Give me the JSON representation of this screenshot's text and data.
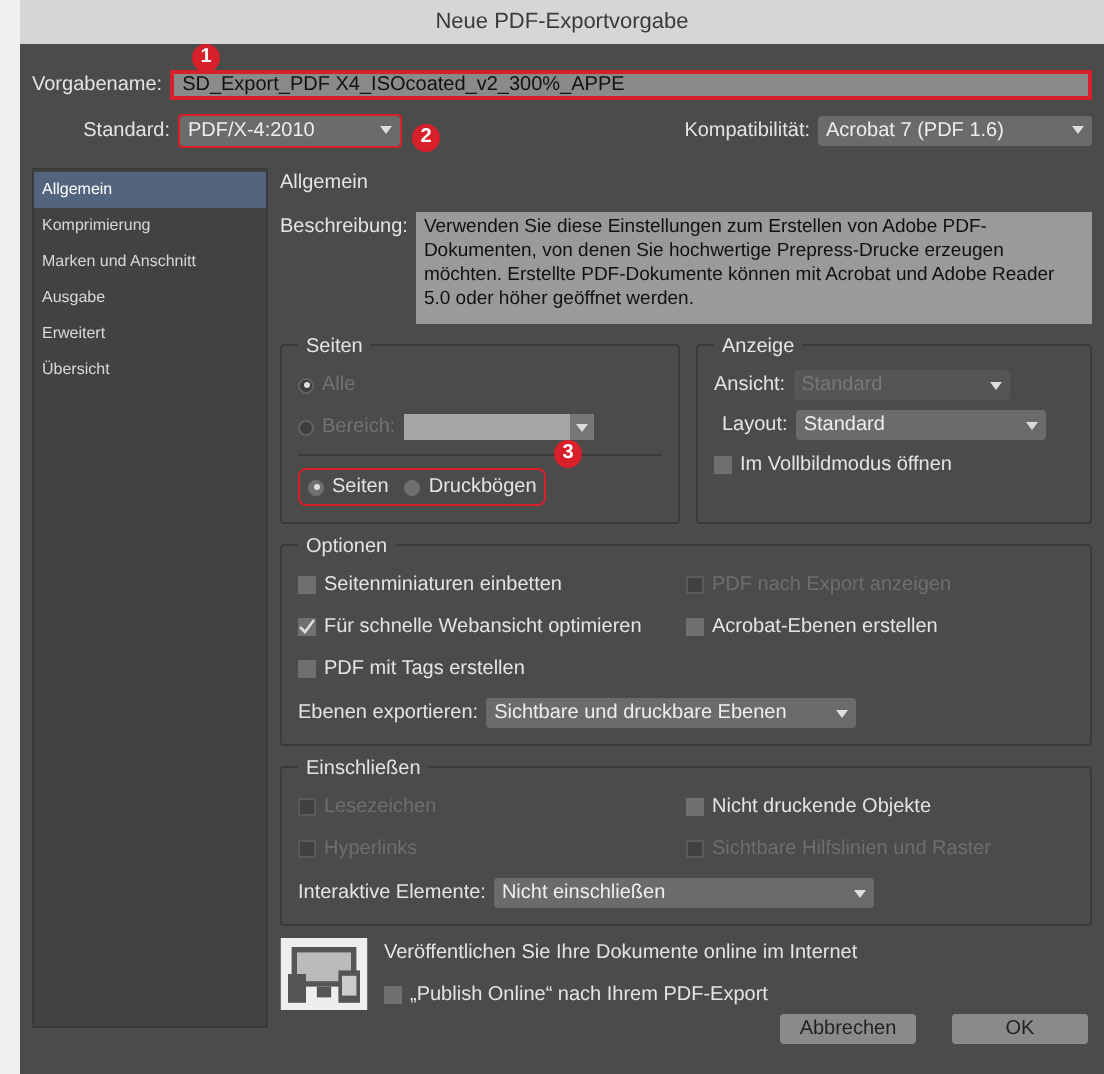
{
  "window": {
    "title": "Neue PDF-Exportvorgabe"
  },
  "preset_name": {
    "label": "Vorgabename:",
    "value": "SD_Export_PDF X4_ISOcoated_v2_300%_APPE",
    "highlighted": true,
    "badge": "1"
  },
  "standard": {
    "label": "Standard:",
    "value": "PDF/X-4:2010",
    "highlighted": true,
    "badge": "2"
  },
  "compatibility": {
    "label": "Kompatibilität:",
    "value": "Acrobat 7 (PDF 1.6)"
  },
  "sidebar": {
    "items": [
      {
        "label": "Allgemein",
        "selected": true
      },
      {
        "label": "Komprimierung",
        "selected": false
      },
      {
        "label": "Marken und Anschnitt",
        "selected": false
      },
      {
        "label": "Ausgabe",
        "selected": false
      },
      {
        "label": "Erweitert",
        "selected": false
      },
      {
        "label": "Übersicht",
        "selected": false
      }
    ]
  },
  "section_title": "Allgemein",
  "description": {
    "label": "Beschreibung:",
    "value": "Verwenden Sie diese Einstellungen zum Erstellen von Adobe PDF-Dokumenten, von denen Sie hochwertige Prepress-Drucke erzeugen möchten. Erstellte PDF-Dokumente können mit Acrobat und Adobe Reader 5.0 oder höher geöffnet werden."
  },
  "pages": {
    "title": "Seiten",
    "range_options": [
      {
        "label": "Alle",
        "selected": true,
        "disabled": true
      },
      {
        "label": "Bereich:",
        "selected": false,
        "disabled": true
      }
    ],
    "mode_options": [
      {
        "label": "Seiten",
        "selected": true
      },
      {
        "label": "Druckbögen",
        "selected": false
      }
    ],
    "highlighted": true,
    "badge": "3"
  },
  "display": {
    "title": "Anzeige",
    "view": {
      "label": "Ansicht:",
      "value": "Standard",
      "disabled": true
    },
    "layout": {
      "label": "Layout:",
      "value": "Standard",
      "disabled": false
    },
    "fullscreen": {
      "label": "Im Vollbildmodus öffnen",
      "checked": false,
      "disabled": false
    }
  },
  "options": {
    "title": "Optionen",
    "checkboxes": [
      {
        "label": "Seitenminiaturen einbetten",
        "checked": false,
        "disabled": false
      },
      {
        "label": "PDF nach Export anzeigen",
        "checked": false,
        "disabled": true
      },
      {
        "label": "Für schnelle Webansicht optimieren",
        "checked": true,
        "disabled": false
      },
      {
        "label": "Acrobat-Ebenen erstellen",
        "checked": false,
        "disabled": false
      },
      {
        "label": "PDF mit Tags erstellen",
        "checked": false,
        "disabled": false
      }
    ],
    "export_layers": {
      "label": "Ebenen exportieren:",
      "value": "Sichtbare und druckbare Ebenen"
    }
  },
  "include": {
    "title": "Einschließen",
    "checkboxes": [
      {
        "label": "Lesezeichen",
        "checked": false,
        "disabled": true
      },
      {
        "label": "Nicht druckende Objekte",
        "checked": false,
        "disabled": false
      },
      {
        "label": "Hyperlinks",
        "checked": false,
        "disabled": true
      },
      {
        "label": "Sichtbare Hilfslinien und Raster",
        "checked": false,
        "disabled": true
      }
    ],
    "interactive": {
      "label": "Interaktive Elemente:",
      "value": "Nicht einschließen"
    }
  },
  "publish": {
    "text": "Veröffentlichen Sie Ihre Dokumente online im Internet",
    "checkbox": {
      "label": "„Publish Online“ nach Ihrem PDF-Export",
      "checked": false,
      "disabled": false
    }
  },
  "buttons": [
    "Abbrechen",
    "OK"
  ]
}
